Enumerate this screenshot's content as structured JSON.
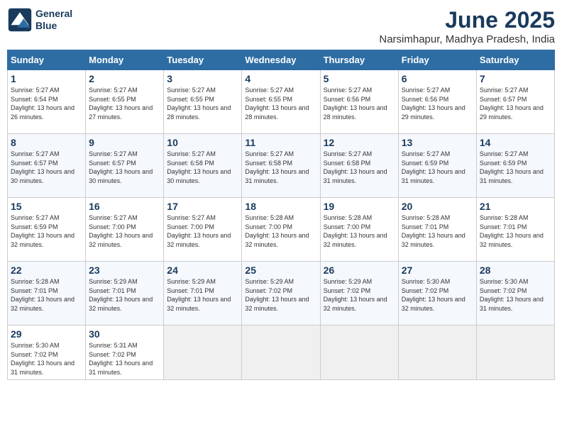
{
  "logo": {
    "line1": "General",
    "line2": "Blue"
  },
  "title": "June 2025",
  "location": "Narsimhapur, Madhya Pradesh, India",
  "headers": [
    "Sunday",
    "Monday",
    "Tuesday",
    "Wednesday",
    "Thursday",
    "Friday",
    "Saturday"
  ],
  "weeks": [
    [
      {
        "day": 1,
        "sunrise": "5:27 AM",
        "sunset": "6:54 PM",
        "daylight": "13 hours and 26 minutes."
      },
      {
        "day": 2,
        "sunrise": "5:27 AM",
        "sunset": "6:55 PM",
        "daylight": "13 hours and 27 minutes."
      },
      {
        "day": 3,
        "sunrise": "5:27 AM",
        "sunset": "6:55 PM",
        "daylight": "13 hours and 28 minutes."
      },
      {
        "day": 4,
        "sunrise": "5:27 AM",
        "sunset": "6:55 PM",
        "daylight": "13 hours and 28 minutes."
      },
      {
        "day": 5,
        "sunrise": "5:27 AM",
        "sunset": "6:56 PM",
        "daylight": "13 hours and 28 minutes."
      },
      {
        "day": 6,
        "sunrise": "5:27 AM",
        "sunset": "6:56 PM",
        "daylight": "13 hours and 29 minutes."
      },
      {
        "day": 7,
        "sunrise": "5:27 AM",
        "sunset": "6:57 PM",
        "daylight": "13 hours and 29 minutes."
      }
    ],
    [
      {
        "day": 8,
        "sunrise": "5:27 AM",
        "sunset": "6:57 PM",
        "daylight": "13 hours and 30 minutes."
      },
      {
        "day": 9,
        "sunrise": "5:27 AM",
        "sunset": "6:57 PM",
        "daylight": "13 hours and 30 minutes."
      },
      {
        "day": 10,
        "sunrise": "5:27 AM",
        "sunset": "6:58 PM",
        "daylight": "13 hours and 30 minutes."
      },
      {
        "day": 11,
        "sunrise": "5:27 AM",
        "sunset": "6:58 PM",
        "daylight": "13 hours and 31 minutes."
      },
      {
        "day": 12,
        "sunrise": "5:27 AM",
        "sunset": "6:58 PM",
        "daylight": "13 hours and 31 minutes."
      },
      {
        "day": 13,
        "sunrise": "5:27 AM",
        "sunset": "6:59 PM",
        "daylight": "13 hours and 31 minutes."
      },
      {
        "day": 14,
        "sunrise": "5:27 AM",
        "sunset": "6:59 PM",
        "daylight": "13 hours and 31 minutes."
      }
    ],
    [
      {
        "day": 15,
        "sunrise": "5:27 AM",
        "sunset": "6:59 PM",
        "daylight": "13 hours and 32 minutes."
      },
      {
        "day": 16,
        "sunrise": "5:27 AM",
        "sunset": "7:00 PM",
        "daylight": "13 hours and 32 minutes."
      },
      {
        "day": 17,
        "sunrise": "5:27 AM",
        "sunset": "7:00 PM",
        "daylight": "13 hours and 32 minutes."
      },
      {
        "day": 18,
        "sunrise": "5:28 AM",
        "sunset": "7:00 PM",
        "daylight": "13 hours and 32 minutes."
      },
      {
        "day": 19,
        "sunrise": "5:28 AM",
        "sunset": "7:00 PM",
        "daylight": "13 hours and 32 minutes."
      },
      {
        "day": 20,
        "sunrise": "5:28 AM",
        "sunset": "7:01 PM",
        "daylight": "13 hours and 32 minutes."
      },
      {
        "day": 21,
        "sunrise": "5:28 AM",
        "sunset": "7:01 PM",
        "daylight": "13 hours and 32 minutes."
      }
    ],
    [
      {
        "day": 22,
        "sunrise": "5:28 AM",
        "sunset": "7:01 PM",
        "daylight": "13 hours and 32 minutes."
      },
      {
        "day": 23,
        "sunrise": "5:29 AM",
        "sunset": "7:01 PM",
        "daylight": "13 hours and 32 minutes."
      },
      {
        "day": 24,
        "sunrise": "5:29 AM",
        "sunset": "7:01 PM",
        "daylight": "13 hours and 32 minutes."
      },
      {
        "day": 25,
        "sunrise": "5:29 AM",
        "sunset": "7:02 PM",
        "daylight": "13 hours and 32 minutes."
      },
      {
        "day": 26,
        "sunrise": "5:29 AM",
        "sunset": "7:02 PM",
        "daylight": "13 hours and 32 minutes."
      },
      {
        "day": 27,
        "sunrise": "5:30 AM",
        "sunset": "7:02 PM",
        "daylight": "13 hours and 32 minutes."
      },
      {
        "day": 28,
        "sunrise": "5:30 AM",
        "sunset": "7:02 PM",
        "daylight": "13 hours and 31 minutes."
      }
    ],
    [
      {
        "day": 29,
        "sunrise": "5:30 AM",
        "sunset": "7:02 PM",
        "daylight": "13 hours and 31 minutes."
      },
      {
        "day": 30,
        "sunrise": "5:31 AM",
        "sunset": "7:02 PM",
        "daylight": "13 hours and 31 minutes."
      },
      null,
      null,
      null,
      null,
      null
    ]
  ]
}
